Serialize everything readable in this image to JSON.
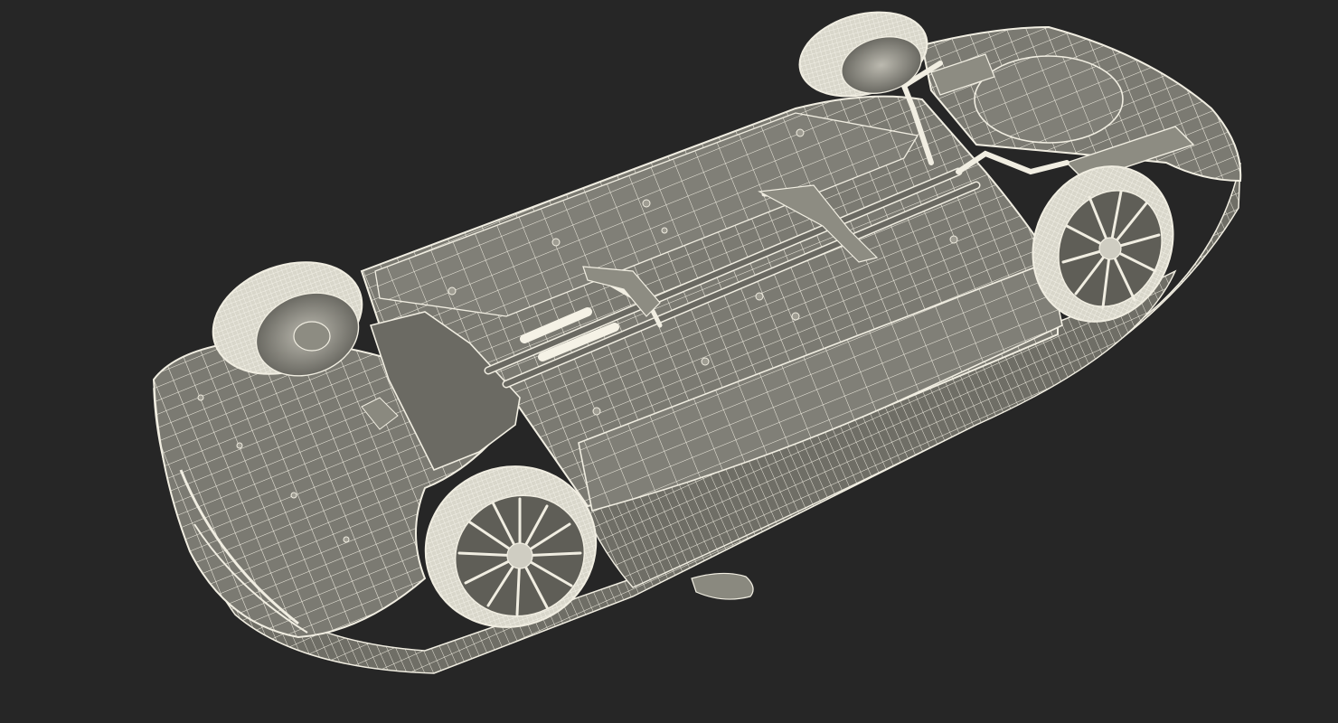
{
  "scene": {
    "subject": "car-underside-wireframe",
    "background_color": "#262626",
    "mesh_face_color": "#7b7a72",
    "mesh_face_dark_color": "#5f5e57",
    "wire_color": "#f1eee2",
    "tire_color": "#dddbcf",
    "wheel_count": 4
  }
}
